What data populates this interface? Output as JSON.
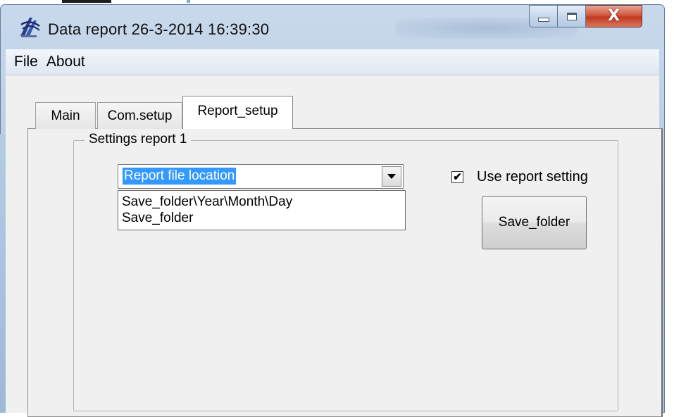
{
  "window": {
    "title": "Data report 26-3-2014 16:39:30",
    "close_symbol": "X"
  },
  "menu": {
    "items": [
      "File",
      "About"
    ]
  },
  "tabs": [
    {
      "label": "Main",
      "selected": false
    },
    {
      "label": "Com.setup",
      "selected": false
    },
    {
      "label": "Report_setup",
      "selected": true
    }
  ],
  "group": {
    "title": "Settings report 1"
  },
  "combo": {
    "value": "Report file location",
    "options": [
      "Save_folder\\Year\\Month\\Day",
      "Save_folder"
    ]
  },
  "checkbox": {
    "label": "Use report setting",
    "checked": true,
    "mark": "✔"
  },
  "button": {
    "label": "Save_folder"
  },
  "icons": {
    "app": "app-logo-icon",
    "minimize": "minimize-icon",
    "maximize": "maximize-icon",
    "close": "close-icon",
    "dropdown": "chevron-down-icon"
  },
  "colors": {
    "selection": "#3399ff",
    "close_button": "#c0381f",
    "title_bar": "#b6cbe3"
  }
}
